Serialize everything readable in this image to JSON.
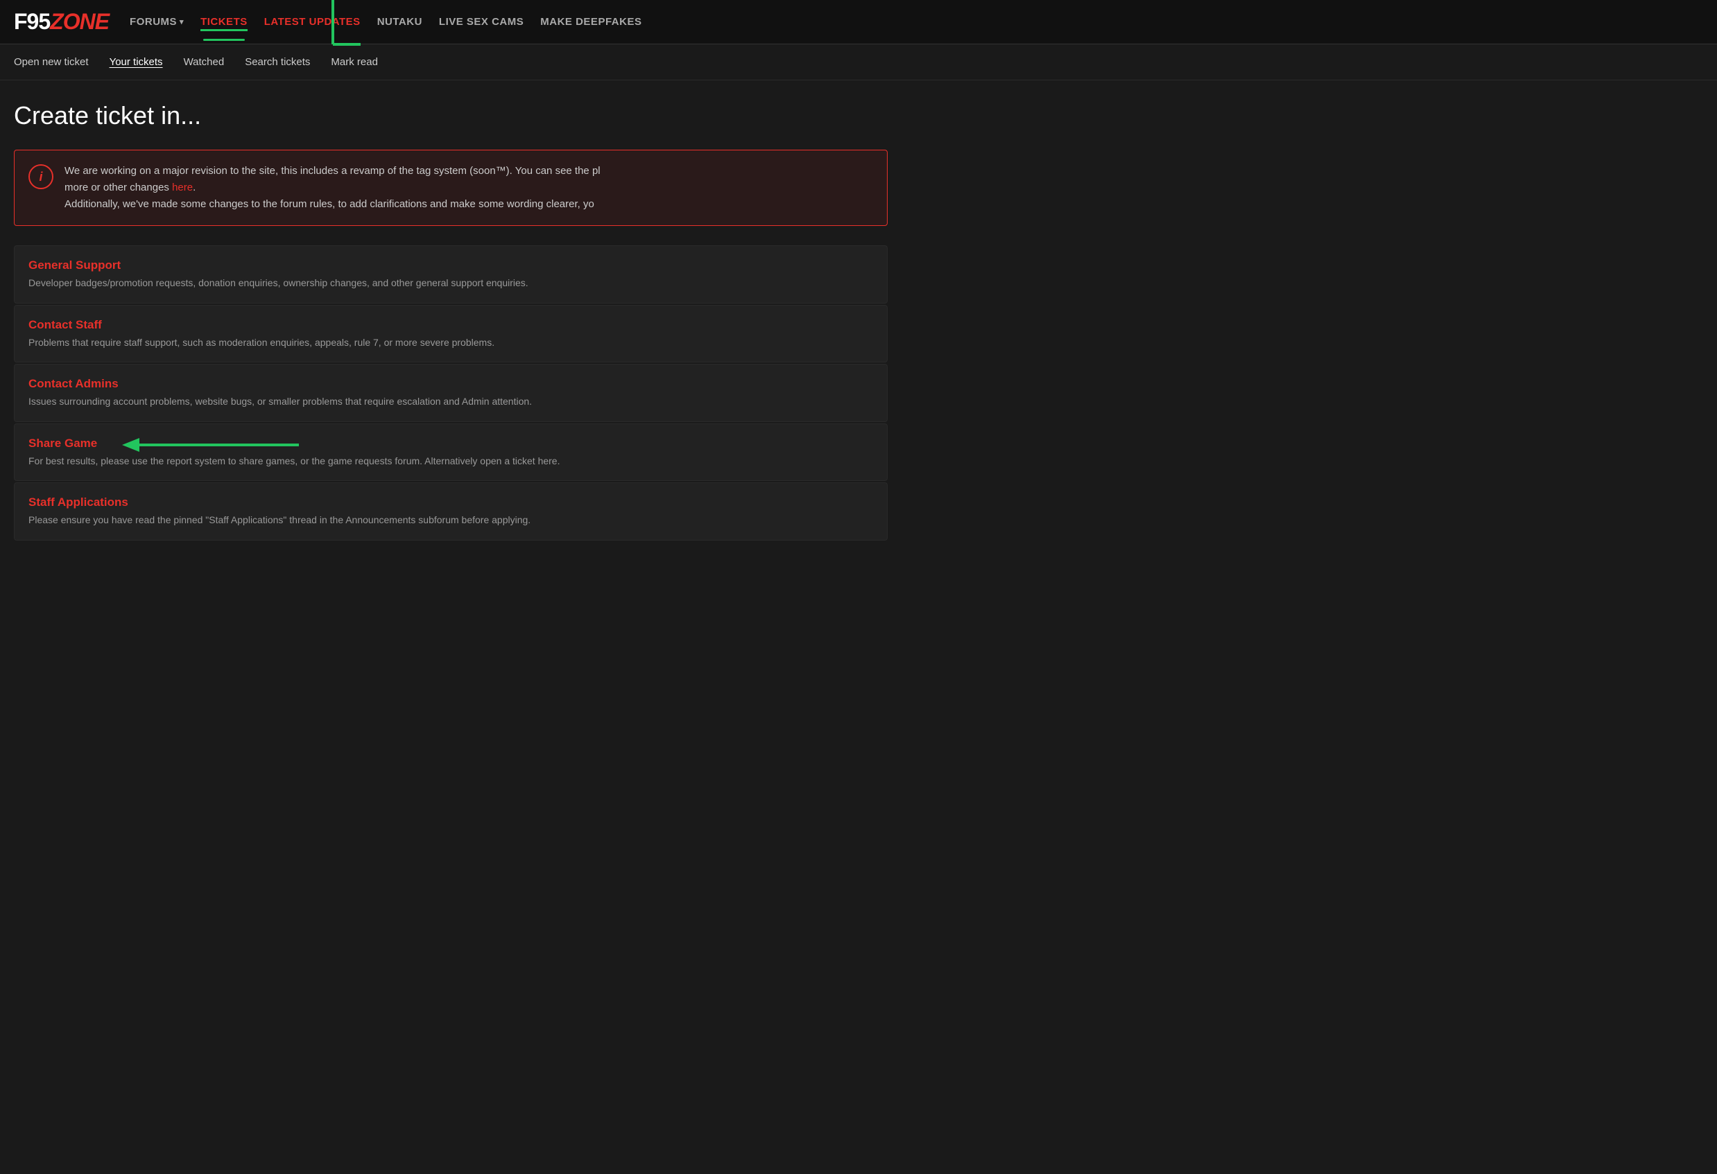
{
  "logo": {
    "f95": "F95",
    "zone": "ZONE"
  },
  "nav": {
    "items": [
      {
        "id": "forums",
        "label": "FORUMS",
        "has_dropdown": true,
        "active": false
      },
      {
        "id": "tickets",
        "label": "TICKETS",
        "active": true
      },
      {
        "id": "latest-updates",
        "label": "LATEST UPDATES",
        "active": false,
        "highlighted": true
      },
      {
        "id": "nutaku",
        "label": "NUTAKU",
        "active": false
      },
      {
        "id": "live-sex-cams",
        "label": "LIVE SEX CAMS",
        "active": false
      },
      {
        "id": "make-deepfakes",
        "label": "MAKE DEEPFAKES",
        "active": false
      }
    ]
  },
  "sub_nav": {
    "items": [
      {
        "id": "open-new-ticket",
        "label": "Open new ticket",
        "active": false
      },
      {
        "id": "your-tickets",
        "label": "Your tickets",
        "active": true
      },
      {
        "id": "watched",
        "label": "Watched",
        "active": false
      },
      {
        "id": "search-tickets",
        "label": "Search tickets",
        "active": false
      },
      {
        "id": "mark-read",
        "label": "Mark read",
        "active": false
      }
    ]
  },
  "page": {
    "title": "Create ticket in..."
  },
  "notice": {
    "text_part1": "We are working on a major revision to the site, this includes a revamp of the tag system (soon™). You can see the pl",
    "text_mid": "more or other changes ",
    "link_label": "here",
    "text_part2": ".",
    "text_part3": "Additionally, we've made some changes to the forum rules, to add clarifications and make some wording clearer, yo"
  },
  "categories": [
    {
      "id": "general-support",
      "title": "General Support",
      "description": "Developer badges/promotion requests, donation enquiries, ownership changes, and other general support enquiries."
    },
    {
      "id": "contact-staff",
      "title": "Contact Staff",
      "description": "Problems that require staff support, such as moderation enquiries, appeals, rule 7, or more severe problems."
    },
    {
      "id": "contact-admins",
      "title": "Contact Admins",
      "description": "Issues surrounding account problems, website bugs, or smaller problems that require escalation and Admin attention."
    },
    {
      "id": "share-game",
      "title": "Share Game",
      "description": "For best results, please use the report system to share games, or the game requests forum. Alternatively open a ticket here."
    },
    {
      "id": "staff-applications",
      "title": "Staff Applications",
      "description": "Please ensure you have read the pinned \"Staff Applications\" thread in the Announcements subforum before applying."
    }
  ],
  "colors": {
    "accent": "#e8302a",
    "green": "#22c55e",
    "bg_dark": "#111111",
    "bg_main": "#1a1a1a",
    "bg_card": "#222222",
    "text_primary": "#ffffff",
    "text_secondary": "#c8c8c8",
    "text_muted": "#999999"
  }
}
